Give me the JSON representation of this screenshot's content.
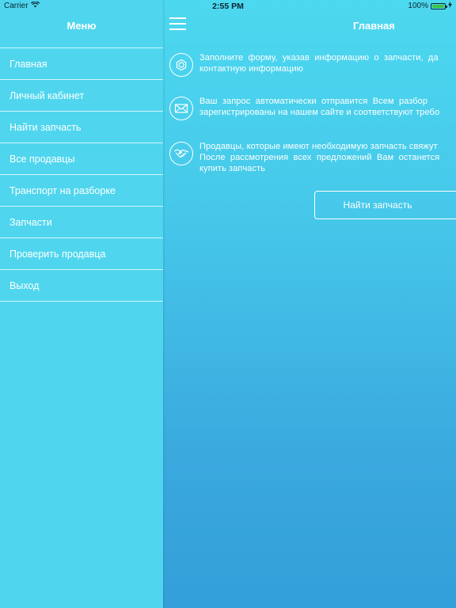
{
  "status_bar": {
    "carrier": "Carrier",
    "time": "2:55 PM",
    "battery": "100%"
  },
  "sidebar": {
    "title": "Меню",
    "items": [
      {
        "label": "Главная"
      },
      {
        "label": "Личный кабинет"
      },
      {
        "label": "Найти запчасть"
      },
      {
        "label": "Все продавцы"
      },
      {
        "label": "Транспорт на разборке"
      },
      {
        "label": "Запчасти"
      },
      {
        "label": "Проверить продавца"
      },
      {
        "label": "Выход"
      }
    ]
  },
  "main": {
    "title": "Главная",
    "features": [
      {
        "icon": "gear-icon",
        "text": "Заполните  форму,  указав  информацию  о  запчасти,  да\nконтактную информацию"
      },
      {
        "icon": "envelope-icon",
        "text": "Ваш  запрос  автоматически  отправится  Всем  разбор\nзарегистрированы на нашем сайте и соответствуют требо"
      },
      {
        "icon": "handshake-icon",
        "text": "Продавцы, которые имеют необходимую запчасть свяжут\nПосле  рассмотрения  всех  предложений  Вам  останется\nкупить запчасть"
      }
    ],
    "find_button_label": "Найти запчасть"
  },
  "colors": {
    "sidebar_bg": "#4fd6ee",
    "main_gradient_top": "#4cd8ef",
    "main_gradient_bottom": "#339fd9",
    "text": "#ffffff",
    "battery_fill": "#3fc24a"
  }
}
